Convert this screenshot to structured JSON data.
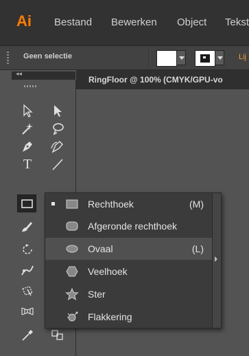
{
  "menubar": {
    "logo": "Ai",
    "items": [
      "Bestand",
      "Bewerken",
      "Object",
      "Tekst"
    ]
  },
  "controlbar": {
    "selection_label": "Geen selectie",
    "cut_label": "Lij"
  },
  "document": {
    "tab_label": "RingFloor @ 100% (CMYK/GPU-vo"
  },
  "toolbar": {
    "collapse": "◂◂",
    "tools": [
      "selection-tool",
      "direct-selection-tool",
      "magic-wand-tool",
      "lasso-tool",
      "pen-tool",
      "curvature-tool",
      "type-tool",
      "line-segment-tool",
      "rectangle-tool",
      "paintbrush-tool",
      "rotate-tool",
      "puppet-warp-tool",
      "free-transform-tool",
      "perspective-grid-tool",
      "eyedropper-tool",
      "blend-tool"
    ]
  },
  "flyout": {
    "items": [
      {
        "label": "Rechthoek",
        "shortcut": "(M)",
        "icon": "rectangle-icon",
        "checked": true
      },
      {
        "label": "Afgeronde rechthoek",
        "shortcut": "",
        "icon": "rounded-rectangle-icon",
        "checked": false
      },
      {
        "label": "Ovaal",
        "shortcut": "(L)",
        "icon": "ellipse-icon",
        "checked": false
      },
      {
        "label": "Veelhoek",
        "shortcut": "",
        "icon": "polygon-icon",
        "checked": false
      },
      {
        "label": "Ster",
        "shortcut": "",
        "icon": "star-icon",
        "checked": false
      },
      {
        "label": "Flakkering",
        "shortcut": "",
        "icon": "flare-icon",
        "checked": false
      }
    ]
  },
  "colors": {
    "accent": "#ff7c00",
    "menubar_bg": "#323232",
    "panel_bg": "#535353",
    "flyout_bg": "#3b3b3b",
    "flyout_highlight": "#505050"
  }
}
